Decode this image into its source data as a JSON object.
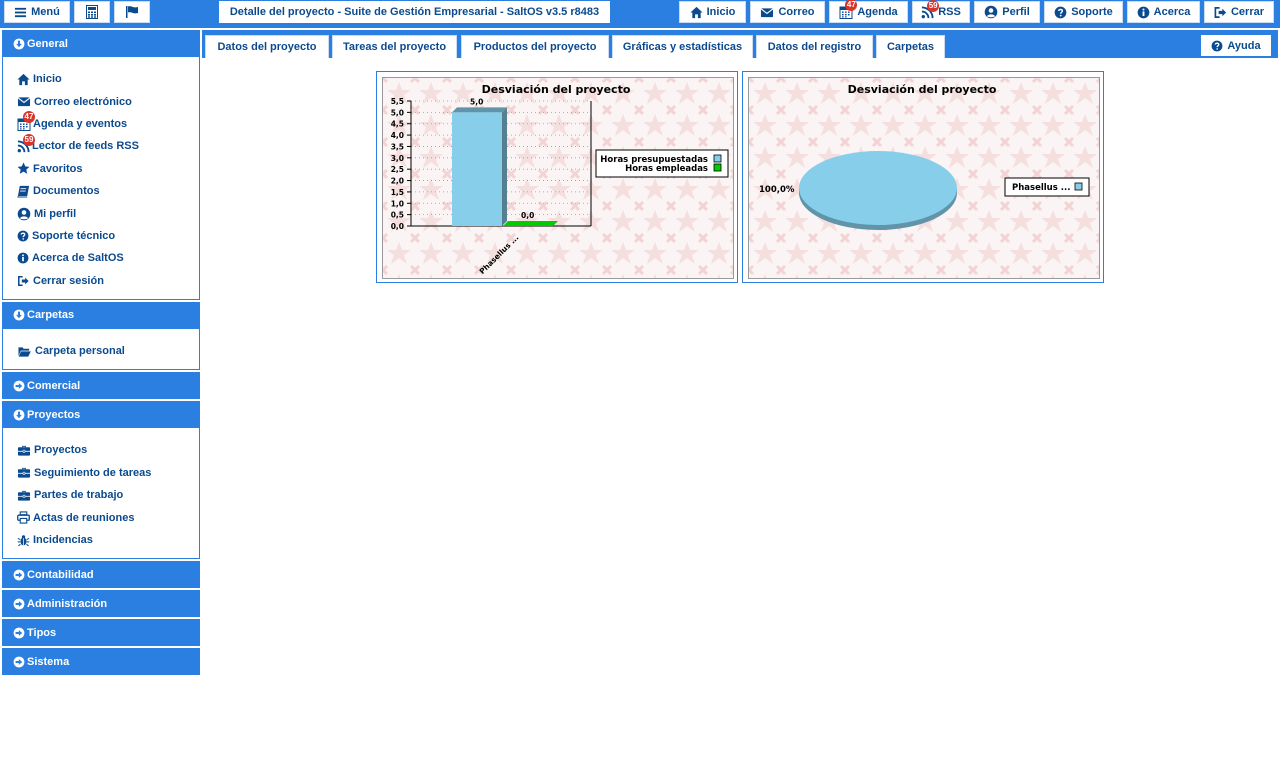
{
  "topbar": {
    "menu_label": "Menú",
    "title": "Detalle del proyecto - Suite de Gestión Empresarial - SaltOS v3.5 r8483",
    "buttons": {
      "home": "Inicio",
      "mail": "Correo",
      "agenda": "Agenda",
      "rss": "RSS",
      "profile": "Perfil",
      "support": "Soporte",
      "about": "Acerca",
      "logout": "Cerrar"
    },
    "agenda_badge": "47",
    "rss_badge": "59"
  },
  "sidebar": {
    "general": {
      "title": "General",
      "items": [
        {
          "label": "Inicio",
          "icon": "home-icon"
        },
        {
          "label": "Correo electrónico",
          "icon": "envelope-icon"
        },
        {
          "label": "Agenda y eventos",
          "icon": "calendar-icon",
          "badge": "47"
        },
        {
          "label": "Lector de feeds RSS",
          "icon": "rss-icon",
          "badge": "59"
        },
        {
          "label": "Favoritos",
          "icon": "star-icon"
        },
        {
          "label": "Documentos",
          "icon": "book-icon"
        },
        {
          "label": "Mi perfil",
          "icon": "user-circle-icon"
        },
        {
          "label": "Soporte técnico",
          "icon": "question-circle-icon"
        },
        {
          "label": "Acerca de SaltOS",
          "icon": "info-circle-icon"
        },
        {
          "label": "Cerrar sesión",
          "icon": "sign-out-icon"
        }
      ]
    },
    "carpetas": {
      "title": "Carpetas",
      "items": [
        {
          "label": "Carpeta personal",
          "icon": "folder-open-icon"
        }
      ]
    },
    "comercial": {
      "title": "Comercial"
    },
    "proyectos": {
      "title": "Proyectos",
      "items": [
        {
          "label": "Proyectos",
          "icon": "briefcase-icon"
        },
        {
          "label": "Seguimiento de tareas",
          "icon": "briefcase-icon"
        },
        {
          "label": "Partes de trabajo",
          "icon": "briefcase-icon"
        },
        {
          "label": "Actas de reuniones",
          "icon": "print-icon"
        },
        {
          "label": "Incidencias",
          "icon": "bug-icon"
        }
      ]
    },
    "contabilidad": {
      "title": "Contabilidad"
    },
    "administracion": {
      "title": "Administración"
    },
    "tipos": {
      "title": "Tipos"
    },
    "sistema": {
      "title": "Sistema"
    }
  },
  "tabs": [
    {
      "label": "Datos del proyecto"
    },
    {
      "label": "Tareas del proyecto"
    },
    {
      "label": "Productos del proyecto"
    },
    {
      "label": "Gráficas y estadísticas",
      "active": true
    },
    {
      "label": "Datos del registro"
    },
    {
      "label": "Carpetas"
    }
  ],
  "help_label": "Ayuda",
  "colors": {
    "accent": "#2a7fe0",
    "link": "#0b4a8e",
    "badge": "#d9342b",
    "bar_budget": "#87ceeb",
    "bar_spent": "#00cc00"
  },
  "chart_data": [
    {
      "type": "bar",
      "title": "Desviación del proyecto",
      "categories": [
        "Phasellus ..."
      ],
      "series": [
        {
          "name": "Horas presupuestadas",
          "values": [
            5.0
          ]
        },
        {
          "name": "Horas empleadas",
          "values": [
            0.0
          ]
        }
      ],
      "value_labels": [
        "5,0",
        "0,0"
      ],
      "ylim": [
        0,
        5.5
      ],
      "yticks": [
        "0,0",
        "0,5",
        "1,0",
        "1,5",
        "2,0",
        "2,5",
        "3,0",
        "3,5",
        "4,0",
        "4,5",
        "5,0",
        "5,5"
      ],
      "grid": true,
      "legend": "right"
    },
    {
      "type": "pie",
      "title": "Desviación del proyecto",
      "categories": [
        "Phasellus ..."
      ],
      "values": [
        100.0
      ],
      "value_labels": [
        "100,0%"
      ],
      "legend": "right"
    }
  ]
}
